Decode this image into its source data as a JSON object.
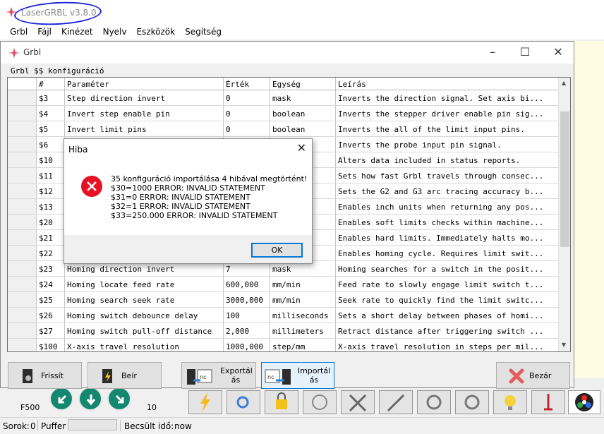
{
  "app": {
    "title": "LaserGRBL v3.8.0",
    "menu": [
      "Grbl",
      "Fájl",
      "Kinézet",
      "Nyelv",
      "Eszközök",
      "Segítség"
    ]
  },
  "grbl_dialog": {
    "title": "Grbl",
    "section_label": "Grbl $$ konfiguráció",
    "columns": [
      "#",
      "Paraméter",
      "Érték",
      "Egység",
      "Leírás"
    ],
    "rows": [
      {
        "num": "$3",
        "param": "Step direction invert",
        "value": "0",
        "unit": "mask",
        "desc": "Inverts the direction signal. Set axis bi..."
      },
      {
        "num": "$4",
        "param": "Invert step enable pin",
        "value": "0",
        "unit": "boolean",
        "desc": "Inverts the stepper driver enable pin sig..."
      },
      {
        "num": "$5",
        "param": "Invert limit pins",
        "value": "0",
        "unit": "boolean",
        "desc": "Inverts the all of the limit input pins."
      },
      {
        "num": "$6",
        "param": "",
        "value": "",
        "unit": "",
        "desc": "Inverts the probe input pin signal."
      },
      {
        "num": "$10",
        "param": "",
        "value": "",
        "unit": "",
        "desc": "Alters data included in status reports."
      },
      {
        "num": "$11",
        "param": "",
        "value": "",
        "unit": "ers",
        "desc": "Sets how fast Grbl travels through consec..."
      },
      {
        "num": "$12",
        "param": "",
        "value": "",
        "unit": "ers",
        "desc": "Sets the G2 and G3 arc tracing accuracy b..."
      },
      {
        "num": "$13",
        "param": "",
        "value": "",
        "unit": "",
        "desc": "Enables inch units when returning any pos..."
      },
      {
        "num": "$20",
        "param": "",
        "value": "",
        "unit": "",
        "desc": "Enables soft limits checks within machine..."
      },
      {
        "num": "$21",
        "param": "",
        "value": "",
        "unit": "",
        "desc": "Enables hard limits. Immediately halts mo..."
      },
      {
        "num": "$22",
        "param": "",
        "value": "",
        "unit": "",
        "desc": "Enables homing cycle. Requires limit swit..."
      },
      {
        "num": "$23",
        "param": "Homing direction invert",
        "value": "7",
        "unit": "mask",
        "desc": "Homing searches for a switch in the posit..."
      },
      {
        "num": "$24",
        "param": "Homing locate feed rate",
        "value": "600,000",
        "unit": "mm/min",
        "desc": "Feed rate to slowly engage limit switch t..."
      },
      {
        "num": "$25",
        "param": "Homing search seek rate",
        "value": "3000,000",
        "unit": "mm/min",
        "desc": "Seek rate to quickly find the limit switc..."
      },
      {
        "num": "$26",
        "param": "Homing switch debounce delay",
        "value": "100",
        "unit": "milliseconds",
        "desc": "Sets a short delay between phases of homi..."
      },
      {
        "num": "$27",
        "param": "Homing switch pull-off distance",
        "value": "2,000",
        "unit": "millimeters",
        "desc": "Retract distance after triggering switch ..."
      },
      {
        "num": "$100",
        "param": "X-axis travel resolution",
        "value": "1000,000",
        "unit": "step/mm",
        "desc": "X-axis travel resolution in steps per mil..."
      }
    ],
    "buttons": {
      "refresh": "Frissít",
      "write": "Beír",
      "export_1": "Exportál",
      "export_2": "ás",
      "import_1": "Importál",
      "import_2": "ás",
      "close": "Bezár"
    }
  },
  "error_dialog": {
    "title": "Hiba",
    "lines": [
      "35 konfiguráció importálása 4 hibával megtörtént!",
      "$30=1000 ERROR: INVALID STATEMENT",
      "$31=0 ERROR: INVALID STATEMENT",
      "$32=1 ERROR: INVALID STATEMENT",
      "$33=250.000 ERROR: INVALID STATEMENT"
    ],
    "ok_label": "OK"
  },
  "bottom": {
    "feed": "F500",
    "step": "10"
  },
  "statusbar": {
    "rows_label": "Sorok:",
    "rows_value": "0",
    "buffer_label": "Puffer",
    "estimated_label": "Becsült idő:",
    "estimated_value": "now"
  },
  "colors": {
    "accent": "#0078d7",
    "jog": "#14876f",
    "error_red": "#e81123",
    "highlight_ink": "#1c25d9"
  }
}
